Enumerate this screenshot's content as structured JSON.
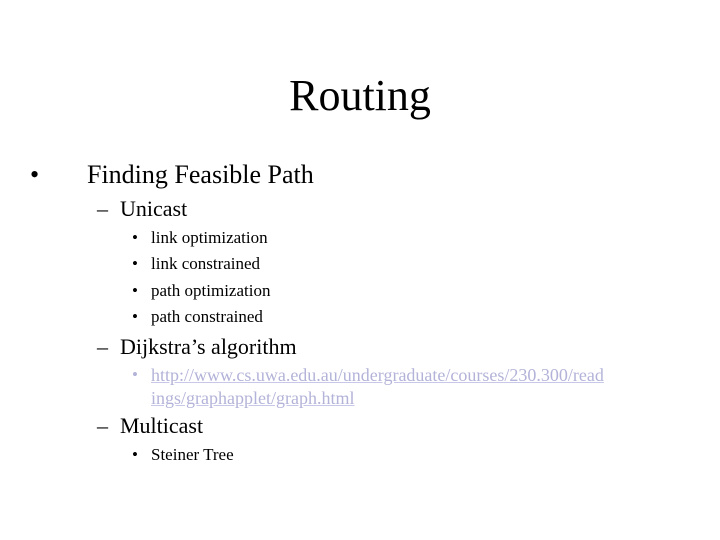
{
  "slide": {
    "title": "Routing",
    "bullets": [
      {
        "marker": "•",
        "text": "Finding Feasible Path",
        "children": [
          {
            "marker": "–",
            "text": "Unicast",
            "children": [
              {
                "marker": "•",
                "text": "link optimization"
              },
              {
                "marker": "•",
                "text": "link constrained"
              },
              {
                "marker": "•",
                "text": "path optimization"
              },
              {
                "marker": "•",
                "text": "path constrained"
              }
            ]
          },
          {
            "marker": "–",
            "text": "Dijkstra’s algorithm",
            "children": [
              {
                "marker": "•",
                "link_line1": "http://www.cs.uwa.edu.au/undergraduate/courses/230.300/read",
                "link_line2": "ings/graphapplet/graph.html"
              }
            ]
          },
          {
            "marker": "–",
            "text": "Multicast",
            "children": [
              {
                "marker": "•",
                "text": "Steiner Tree"
              }
            ]
          }
        ]
      }
    ],
    "colors": {
      "text": "#000000",
      "link": "#b3b3d9",
      "background": "#ffffff"
    }
  }
}
